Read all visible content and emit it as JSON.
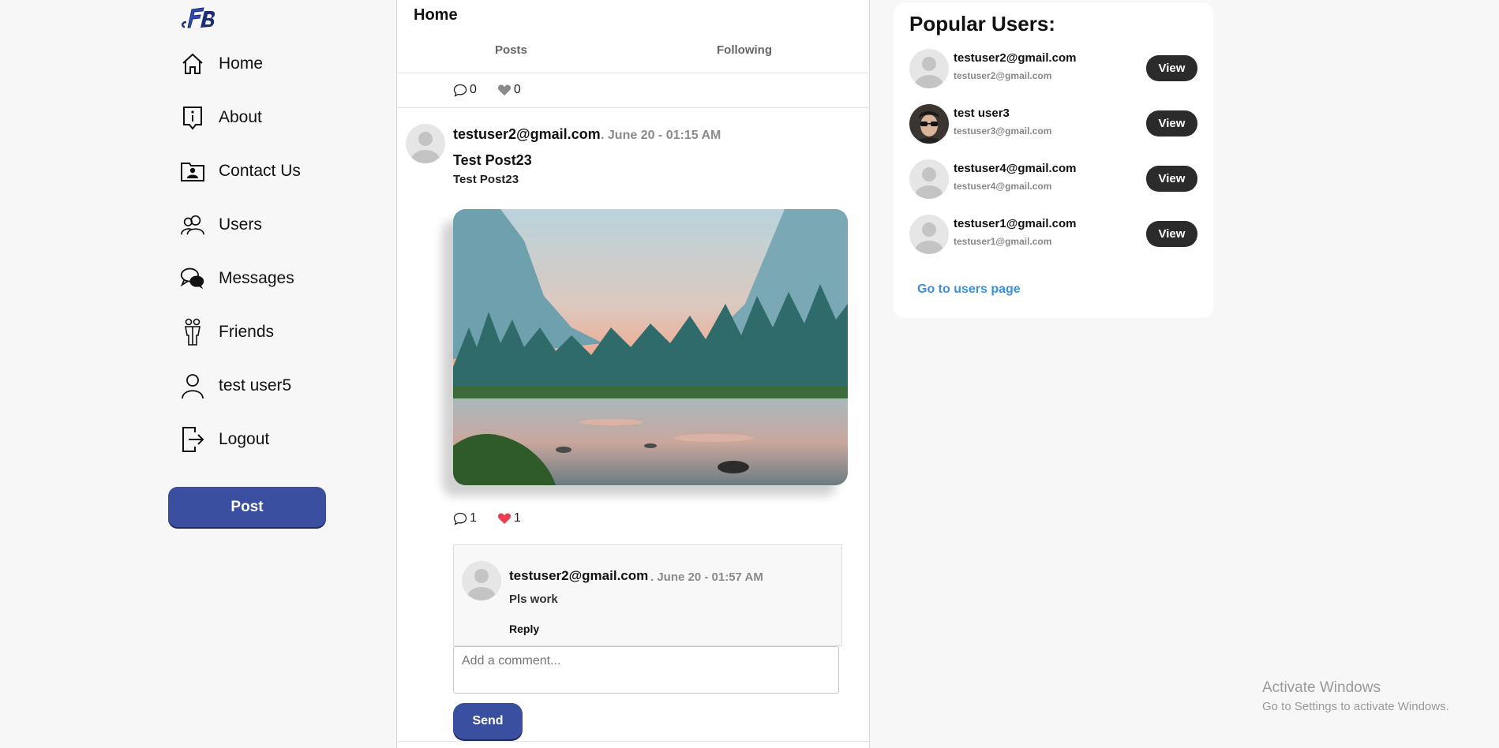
{
  "sidebar": {
    "logo_text": "FB",
    "items": [
      {
        "label": "Home",
        "icon": "home-icon"
      },
      {
        "label": "About",
        "icon": "info-icon"
      },
      {
        "label": "Contact Us",
        "icon": "contact-card-icon"
      },
      {
        "label": "Users",
        "icon": "users-icon"
      },
      {
        "label": "Messages",
        "icon": "chat-bubbles-icon"
      },
      {
        "label": "Friends",
        "icon": "friends-icon"
      },
      {
        "label": "test user5",
        "icon": "user-icon"
      },
      {
        "label": "Logout",
        "icon": "logout-icon"
      }
    ],
    "post_button": "Post"
  },
  "feed": {
    "title": "Home",
    "tabs": [
      {
        "label": "Posts"
      },
      {
        "label": "Following"
      }
    ],
    "previous_post": {
      "comments": "0",
      "likes": "0"
    },
    "post": {
      "author": "testuser2@gmail.com",
      "date": ". June 20 - 01:15 AM",
      "title": "Test Post23",
      "body": "Test Post23",
      "image": "mountain-river-landscape-image",
      "comments": "1",
      "likes": "1",
      "comment": {
        "author": "testuser2@gmail.com",
        "date": ". June 20 - 01:57 AM",
        "text": "Pls work",
        "reply_label": "Reply"
      },
      "comment_placeholder": "Add a comment...",
      "send_label": "Send"
    }
  },
  "popular": {
    "title": "Popular Users:",
    "users": [
      {
        "name": "testuser2@gmail.com",
        "email": "testuser2@gmail.com",
        "avatar": "default-avatar",
        "button": "View"
      },
      {
        "name": "test user3",
        "email": "testuser3@gmail.com",
        "avatar": "photo-avatar",
        "button": "View"
      },
      {
        "name": "testuser4@gmail.com",
        "email": "testuser4@gmail.com",
        "avatar": "default-avatar",
        "button": "View"
      },
      {
        "name": "testuser1@gmail.com",
        "email": "testuser1@gmail.com",
        "avatar": "default-avatar",
        "button": "View"
      }
    ],
    "link": "Go to users page"
  },
  "watermark": {
    "title": "Activate Windows",
    "subtitle": "Go to Settings to activate Windows."
  },
  "colors": {
    "primary_button": "#3a4fa0",
    "like_active": "#e8404f",
    "link": "#3b8fe0",
    "view_button": "#2b2b2b"
  }
}
